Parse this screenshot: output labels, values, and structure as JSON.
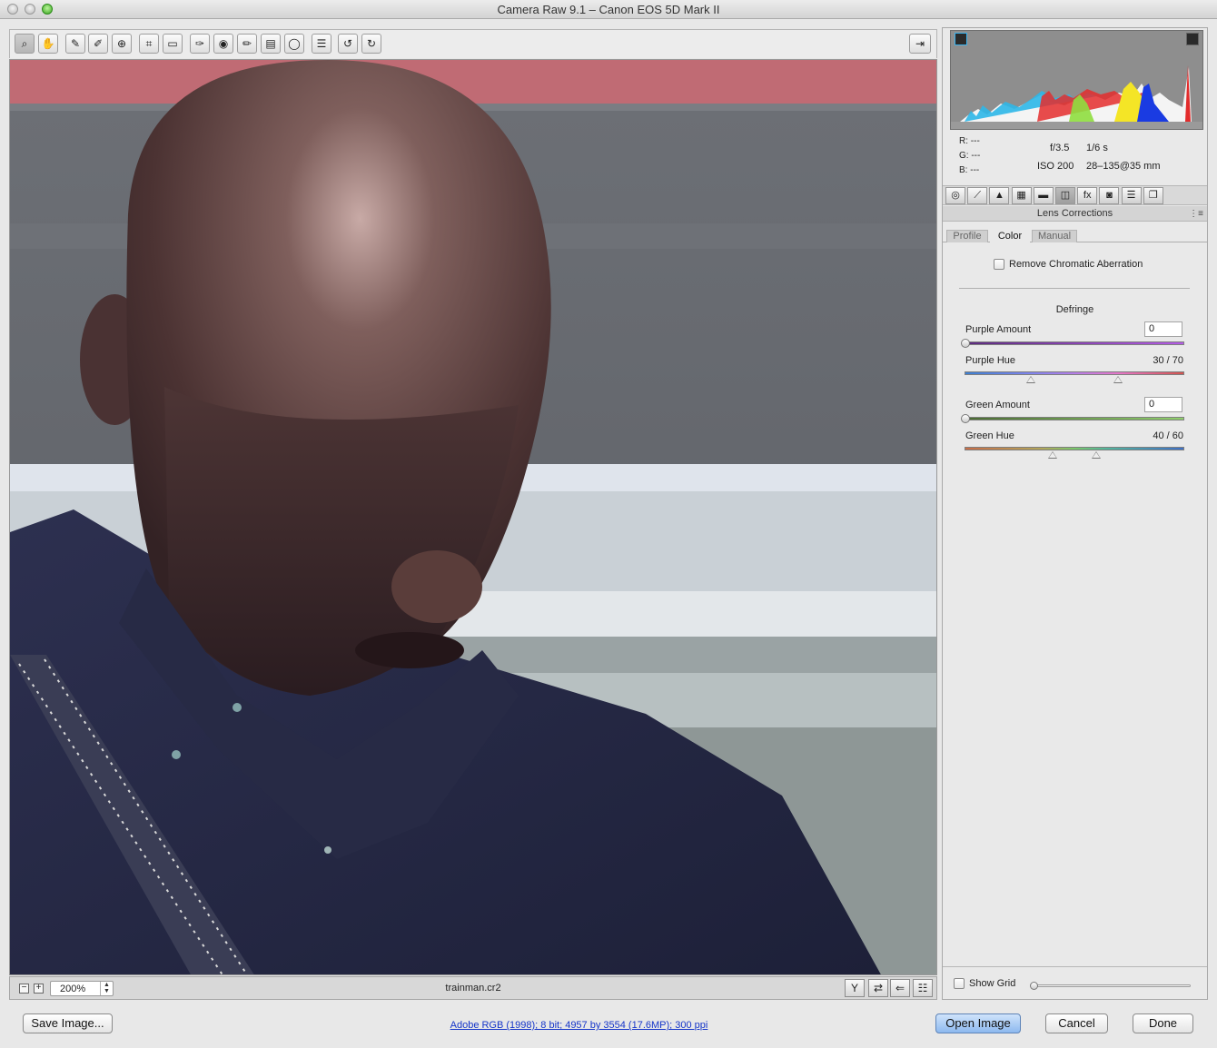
{
  "window": {
    "title": "Camera Raw 9.1  –  Canon EOS 5D Mark II"
  },
  "toolbar": {
    "tools": [
      {
        "name": "zoom-tool",
        "icon": "magnifier-icon",
        "glyph": "⌕",
        "active": true
      },
      {
        "name": "hand-tool",
        "icon": "hand-icon",
        "glyph": "✋",
        "active": false
      },
      {
        "name": "white-balance-tool",
        "icon": "eyedropper-icon",
        "glyph": "✎",
        "active": false
      },
      {
        "name": "color-sampler-tool",
        "icon": "sampler-icon",
        "glyph": "✐",
        "active": false
      },
      {
        "name": "targeted-adjustment-tool",
        "icon": "target-adjust-icon",
        "glyph": "⊕",
        "active": false
      },
      {
        "name": "crop-tool",
        "icon": "crop-icon",
        "glyph": "⌗",
        "active": false
      },
      {
        "name": "straighten-tool",
        "icon": "straighten-icon",
        "glyph": "▭",
        "active": false
      },
      {
        "name": "spot-removal-tool",
        "icon": "spot-removal-icon",
        "glyph": "✑",
        "active": false
      },
      {
        "name": "red-eye-tool",
        "icon": "eye-icon",
        "glyph": "◉",
        "active": false
      },
      {
        "name": "adjustment-brush-tool",
        "icon": "brush-icon",
        "glyph": "✏",
        "active": false
      },
      {
        "name": "graduated-filter-tool",
        "icon": "graduated-filter-icon",
        "glyph": "▤",
        "active": false
      },
      {
        "name": "radial-filter-tool",
        "icon": "radial-filter-icon",
        "glyph": "◯",
        "active": false
      },
      {
        "name": "preferences-tool",
        "icon": "list-icon",
        "glyph": "☰",
        "active": false
      },
      {
        "name": "rotate-left-tool",
        "icon": "rotate-ccw-icon",
        "glyph": "↺",
        "active": false
      },
      {
        "name": "rotate-right-tool",
        "icon": "rotate-cw-icon",
        "glyph": "↻",
        "active": false
      }
    ],
    "fullscreen_glyph": "⇥"
  },
  "preview": {
    "zoom_value": "200%",
    "filename": "trainman.cr2",
    "view_buttons": [
      {
        "name": "before-after-view-button",
        "icon": "y-split-icon",
        "glyph": "Y"
      },
      {
        "name": "swap-settings-button",
        "icon": "swap-icon",
        "glyph": "⇄"
      },
      {
        "name": "copy-settings-button",
        "icon": "copy-settings-icon",
        "glyph": "⇐"
      },
      {
        "name": "toggle-settings-button",
        "icon": "sliders-icon",
        "glyph": "☷"
      }
    ]
  },
  "histogram": {
    "r_label": "R:",
    "r_value": "---",
    "g_label": "G:",
    "g_value": "---",
    "b_label": "B:",
    "b_value": "---",
    "aperture": "f/3.5",
    "shutter": "1/6 s",
    "iso": "ISO 200",
    "lens": "28–135@35 mm"
  },
  "panel": {
    "tab_icons": [
      {
        "name": "tab-basic",
        "icon": "aperture-icon",
        "glyph": "◎"
      },
      {
        "name": "tab-tone-curve",
        "icon": "curve-icon",
        "glyph": "⟋"
      },
      {
        "name": "tab-detail",
        "icon": "triangle-icon",
        "glyph": "▲"
      },
      {
        "name": "tab-hsl",
        "icon": "hsl-icon",
        "glyph": "▦"
      },
      {
        "name": "tab-split-toning",
        "icon": "split-tone-icon",
        "glyph": "▬"
      },
      {
        "name": "tab-lens-corrections",
        "icon": "lens-icon",
        "glyph": "◫",
        "active": true
      },
      {
        "name": "tab-effects",
        "icon": "fx-icon",
        "glyph": "fx"
      },
      {
        "name": "tab-camera-calibration",
        "icon": "camera-icon",
        "glyph": "◙"
      },
      {
        "name": "tab-presets",
        "icon": "presets-icon",
        "glyph": "☰"
      },
      {
        "name": "tab-snapshots",
        "icon": "snapshots-icon",
        "glyph": "❐"
      }
    ],
    "section_title": "Lens Corrections",
    "menu_glyph": "⋮≡",
    "subtabs": {
      "profile": "Profile",
      "color": "Color",
      "manual": "Manual"
    },
    "remove_ca_label": "Remove Chromatic Aberration",
    "defringe_label": "Defringe",
    "purple_amount": {
      "label": "Purple Amount",
      "value": "0",
      "level": 0
    },
    "purple_hue": {
      "label": "Purple Hue",
      "value": "30 / 70",
      "low": 30,
      "high": 70
    },
    "green_amount": {
      "label": "Green Amount",
      "value": "0",
      "level": 0
    },
    "green_hue": {
      "label": "Green Hue",
      "value": "40 / 60",
      "low": 40,
      "high": 60
    },
    "show_grid_label": "Show Grid"
  },
  "footer": {
    "save_label": "Save Image...",
    "workflow_link": "Adobe RGB (1998); 8 bit; 4957 by 3554 (17.6MP); 300 ppi",
    "open_label": "Open Image",
    "cancel_label": "Cancel",
    "done_label": "Done"
  },
  "colors": {
    "accent": "#8db9ef",
    "link": "#1535c9",
    "purple_track": "#a24bd6",
    "green_track": "#7bc15d"
  }
}
